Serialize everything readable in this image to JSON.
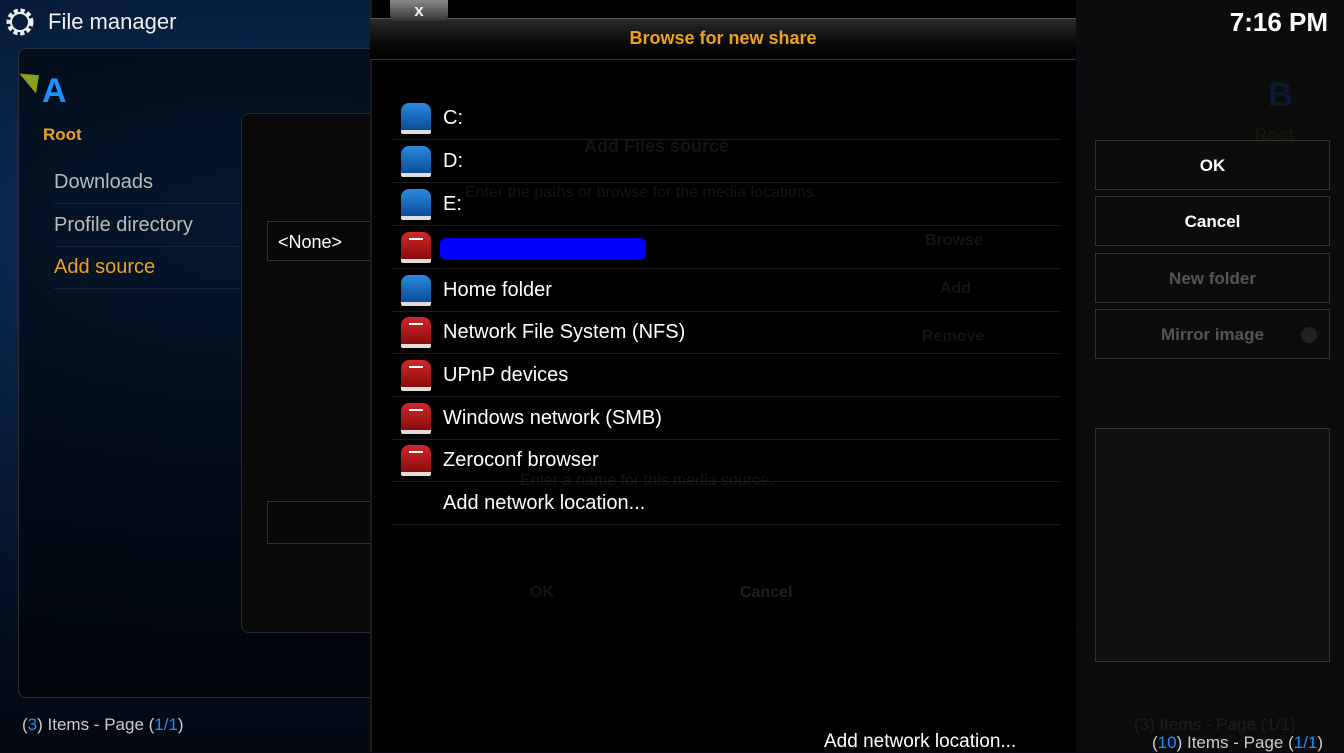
{
  "header": {
    "title": "File manager",
    "clock": "7:16 PM"
  },
  "left_panel": {
    "letter": "A",
    "root": "Root",
    "items": [
      {
        "label": "Downloads"
      },
      {
        "label": "Profile directory"
      },
      {
        "label": "Add source",
        "selected": true
      }
    ],
    "footer": {
      "count": "3",
      "page": "1/1"
    }
  },
  "background_dialog": {
    "title": "Add Files source",
    "hint": "Enter the paths or browse for the media locations.",
    "path_value": "<None>",
    "buttons": [
      "Browse",
      "Add",
      "Remove"
    ],
    "name_hint": "Enter a name for this media source.",
    "ok": "OK",
    "cancel": "Cancel",
    "right_letter": "B",
    "right_root": "Root",
    "right_footer": {
      "count": "3",
      "page": "1/1"
    }
  },
  "browse_dialog": {
    "title": "Browse for new share",
    "close": "x",
    "items": [
      {
        "label": "C:",
        "icon": "drive-icon"
      },
      {
        "label": "D:",
        "icon": "drive-icon"
      },
      {
        "label": "E:",
        "icon": "drive-icon"
      },
      {
        "label": "",
        "icon": "network-drive-icon",
        "redacted": true
      },
      {
        "label": "Home folder",
        "icon": "drive-icon"
      },
      {
        "label": "Network File System (NFS)",
        "icon": "network-drive-icon"
      },
      {
        "label": "UPnP devices",
        "icon": "network-drive-icon"
      },
      {
        "label": "Windows network (SMB)",
        "icon": "network-drive-icon"
      },
      {
        "label": "Zeroconf browser",
        "icon": "network-drive-icon"
      },
      {
        "label": "Add network location...",
        "icon": ""
      }
    ],
    "selected_label": "Add network location...",
    "footer": {
      "count": "10",
      "page": "1/1"
    }
  },
  "right_panel": {
    "buttons": [
      {
        "label": "OK",
        "enabled": true
      },
      {
        "label": "Cancel",
        "enabled": true
      },
      {
        "label": "New folder",
        "enabled": false
      },
      {
        "label": "Mirror image",
        "enabled": false
      }
    ]
  },
  "colors": {
    "accent": "#f0a020",
    "highlight": "#1e90ff",
    "redaction": "#0000ff"
  }
}
